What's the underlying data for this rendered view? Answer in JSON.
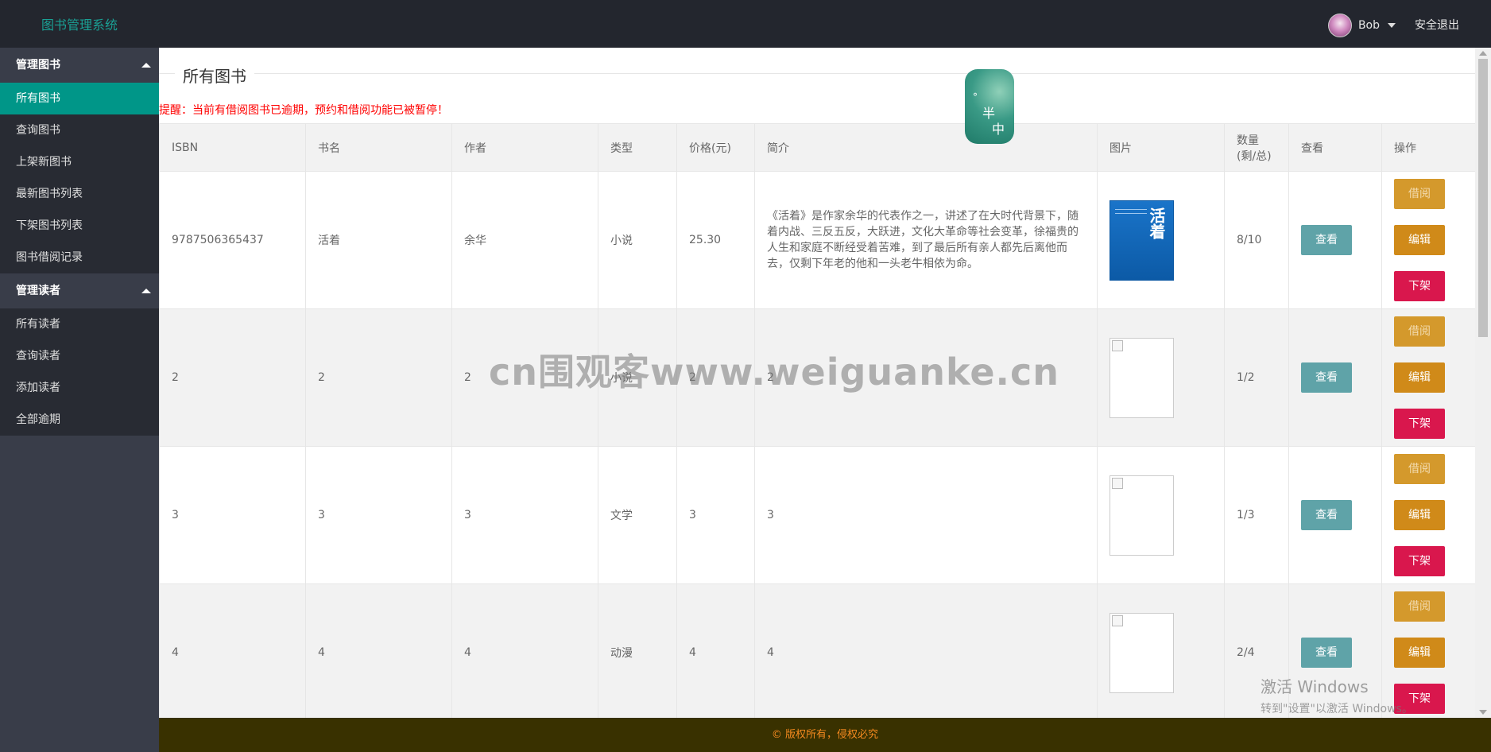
{
  "header": {
    "brand": "图书管理系统",
    "user_name": "Bob",
    "logout": "安全退出"
  },
  "sidebar": {
    "sections": [
      {
        "title": "管理图书",
        "items": [
          "所有图书",
          "查询图书",
          "上架新图书",
          "最新图书列表",
          "下架图书列表",
          "图书借阅记录"
        ]
      },
      {
        "title": "管理读者",
        "items": [
          "所有读者",
          "查询读者",
          "添加读者",
          "全部逾期"
        ]
      }
    ],
    "active_item": "所有图书"
  },
  "main": {
    "legend": "所有图书",
    "warning": "提醒：当前有借阅图书已逾期，预约和借阅功能已被暂停！",
    "columns": [
      "ISBN",
      "书名",
      "作者",
      "类型",
      "价格(元)",
      "简介",
      "图片",
      "数量(剩/总)",
      "查看",
      "操作"
    ],
    "rows": [
      {
        "isbn": "9787506365437",
        "name": "活着",
        "author": "余华",
        "type": "小说",
        "price": "25.30",
        "desc": "《活着》是作家余华的代表作之一，讲述了在大时代背景下，随着内战、三反五反，大跃进，文化大革命等社会变革，徐福贵的人生和家庭不断经受着苦难，到了最后所有亲人都先后离他而去，仅剩下年老的他和一头老牛相依为命。",
        "cover_title": "活着",
        "qty": "8/10"
      },
      {
        "isbn": "2",
        "name": "2",
        "author": "2",
        "type": "小说",
        "price": "2",
        "desc": "2",
        "cover_title": "",
        "qty": "1/2"
      },
      {
        "isbn": "3",
        "name": "3",
        "author": "3",
        "type": "文学",
        "price": "3",
        "desc": "3",
        "cover_title": "",
        "qty": "1/3"
      },
      {
        "isbn": "4",
        "name": "4",
        "author": "4",
        "type": "动漫",
        "price": "4",
        "desc": "4",
        "cover_title": "",
        "qty": "2/4"
      }
    ],
    "buttons": {
      "view": "查看",
      "borrow": "借阅",
      "edit": "编辑",
      "off_shelf": "下架"
    }
  },
  "footer": {
    "text": "© 版权所有，侵权必究"
  },
  "overlays": {
    "badge_top": "半",
    "badge_bottom": "中",
    "watermark": "cn围观客www.weiguanke.cn",
    "activate_title": "激活 Windows",
    "activate_sub": "转到\"设置\"以激活 Windows。"
  },
  "colors": {
    "topbar": "#23262e",
    "sidebar": "#393d49",
    "active": "#009688",
    "brand": "#1aa094",
    "warning": "#ff0000",
    "btn_view": "#5fa3a8",
    "btn_borrow": "#d4992c",
    "btn_edit": "#d08a19",
    "btn_off": "#d9174d",
    "footer_bg": "#393100",
    "footer_text": "#f58a1f"
  }
}
